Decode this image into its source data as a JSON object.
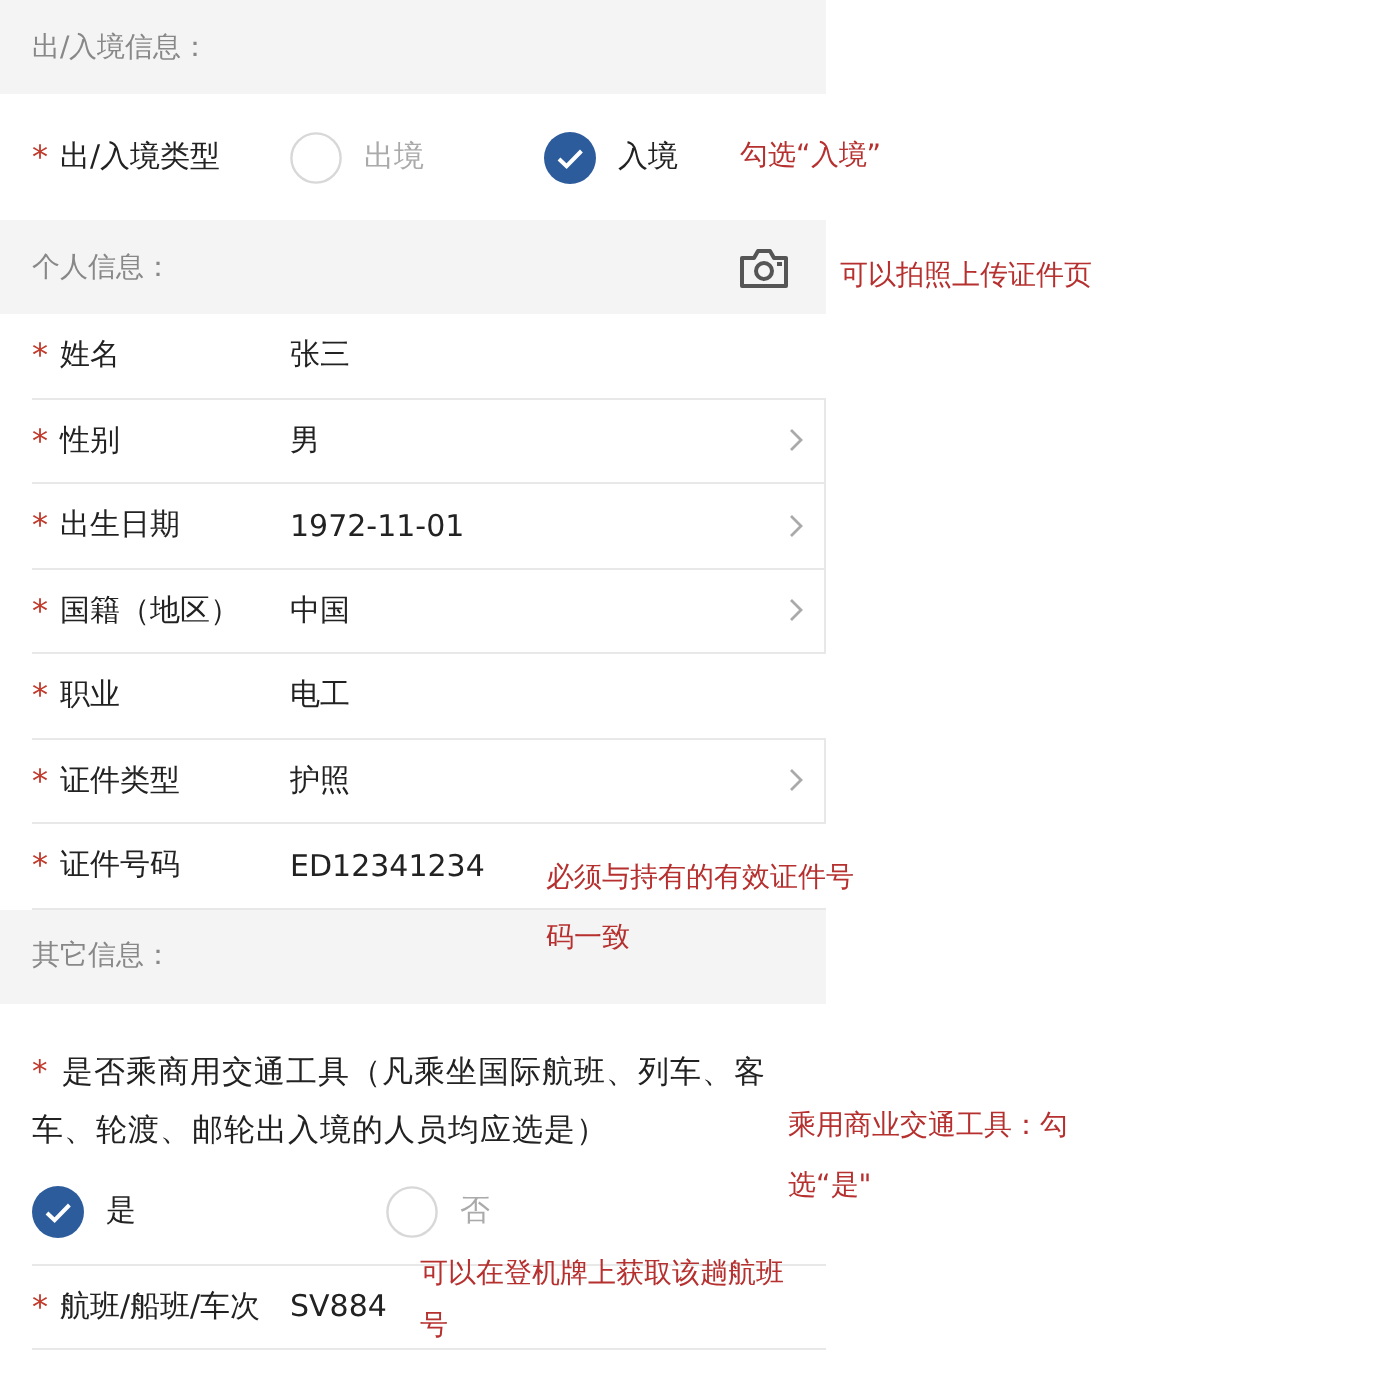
{
  "sections": [
    {
      "title": "出/入境信息：",
      "camera": false,
      "items": [
        {
          "kind": "radio",
          "mark": "*",
          "label": "出/入境类型",
          "options": [
            {
              "label": "出境",
              "selected": false
            },
            {
              "label": "入境",
              "selected": true
            }
          ],
          "note": "勾选“入境”"
        }
      ]
    },
    {
      "title": "个人信息：",
      "camera": true,
      "note": "可以拍照上传证件页",
      "items": [
        {
          "kind": "text",
          "mark": "*",
          "label": "姓名",
          "value": "张三"
        },
        {
          "kind": "select",
          "mark": "*",
          "label": "性别",
          "value": "男"
        },
        {
          "kind": "select",
          "mark": "*",
          "label": "出生日期",
          "value": "1972-11-01"
        },
        {
          "kind": "select",
          "mark": "*",
          "label": "国籍（地区）",
          "value": "中国"
        },
        {
          "kind": "text",
          "mark": "*",
          "label": "职业",
          "value": "电工"
        },
        {
          "kind": "select",
          "mark": "*",
          "label": "证件类型",
          "value": "护照"
        },
        {
          "kind": "text",
          "mark": "*",
          "label": "证件号码",
          "value": "ED12341234",
          "note": "必须与持有的有效证件号码一致"
        }
      ]
    },
    {
      "title": "其它信息：",
      "camera": false,
      "items": [
        {
          "kind": "question",
          "mark": "*",
          "label": "是否乘商用交通工具（凡乘坐国际航班、列车、客车、轮渡、邮轮出入境的人员均应选是）",
          "options": [
            {
              "label": "是",
              "selected": true
            },
            {
              "label": "否",
              "selected": false
            }
          ],
          "note": "乘用商业交通工具：勾选“是\""
        },
        {
          "kind": "text",
          "mark": "*",
          "label": "航班/船班/车次",
          "value": "SV884",
          "note": "可以在登机牌上获取该趟航班号"
        }
      ]
    }
  ]
}
